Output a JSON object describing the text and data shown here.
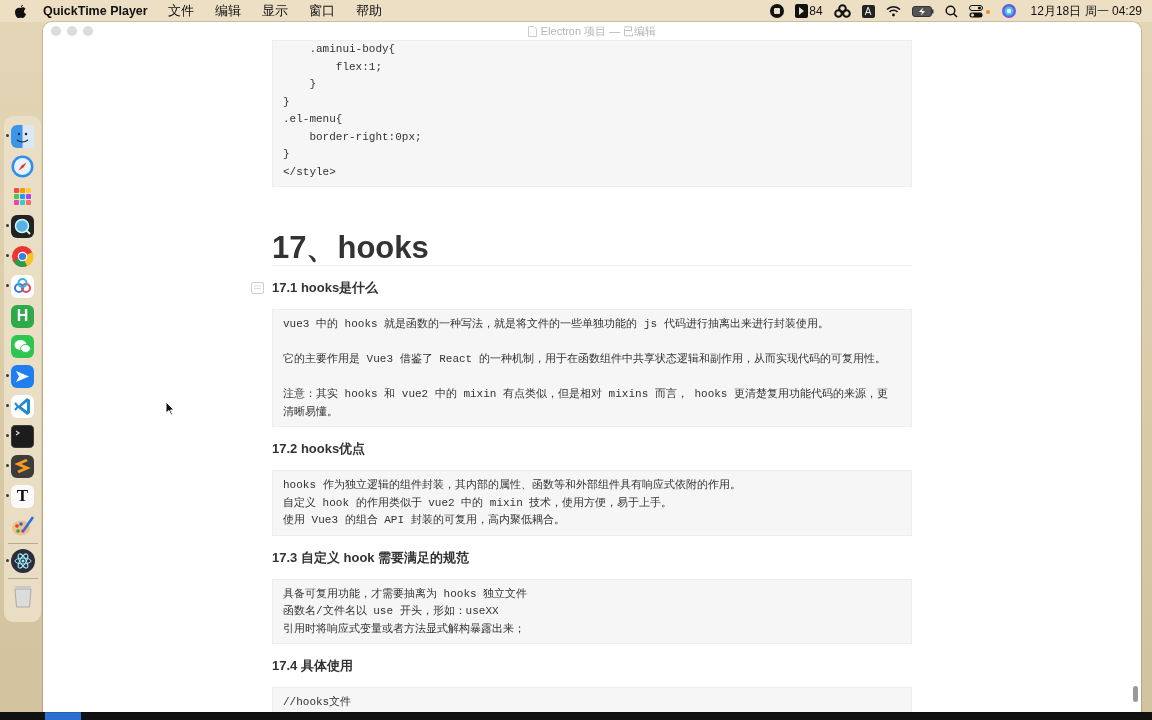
{
  "menu_bar": {
    "app_name": "QuickTime Player",
    "menus": [
      "文件",
      "编辑",
      "显示",
      "窗口",
      "帮助"
    ],
    "status": {
      "badge_count": "84",
      "input_method": "A",
      "clock": "12月18日 周一 04:29"
    }
  },
  "dock": {
    "items": [
      {
        "kind": "finder",
        "running": true
      },
      {
        "kind": "safari",
        "running": false
      },
      {
        "kind": "launchpad",
        "running": false
      },
      {
        "kind": "quicktime",
        "running": true
      },
      {
        "kind": "chrome",
        "running": true
      },
      {
        "kind": "baidu",
        "running": true
      },
      {
        "kind": "letter",
        "label": "H",
        "running": false
      },
      {
        "kind": "wechat",
        "running": false
      },
      {
        "kind": "feishu",
        "running": true
      },
      {
        "kind": "vscode",
        "running": true
      },
      {
        "kind": "terminal",
        "running": true
      },
      {
        "kind": "sublime",
        "running": true
      },
      {
        "kind": "serif",
        "label": "T",
        "running": true
      },
      {
        "kind": "paint",
        "running": false
      },
      {
        "kind": "separator"
      },
      {
        "kind": "electron",
        "running": true
      },
      {
        "kind": "separator"
      },
      {
        "kind": "trash",
        "running": false
      }
    ]
  },
  "window": {
    "title": "Electron 项目 — 已编辑"
  },
  "document": [
    {
      "kind": "code",
      "paragraphs": [
        [
          "    .aminui-body{",
          "        flex:1;",
          "    }",
          "}",
          ".el-menu{",
          "    border-right:0px;",
          "}",
          "</style>"
        ]
      ]
    },
    {
      "kind": "h1",
      "text": "17、hooks"
    },
    {
      "kind": "h2",
      "text": "17.1 hooks是什么",
      "handle": true
    },
    {
      "kind": "code",
      "paragraphs": [
        [
          "vue3 中的 hooks 就是函数的一种写法，就是将文件的一些单独功能的 js 代码进行抽离出来进行封装使用。"
        ],
        [
          "它的主要作用是 Vue3 借鉴了 React 的一种机制，用于在函数组件中共享状态逻辑和副作用，从而实现代码的可复用性。"
        ],
        [
          "注意：其实 hooks 和 vue2 中的 mixin 有点类似，但是相对 mixins 而言， hooks 更清楚复用功能代码的来源，更",
          "清晰易懂。"
        ]
      ]
    },
    {
      "kind": "h2",
      "text": "17.2 hooks优点"
    },
    {
      "kind": "code",
      "paragraphs": [
        [
          "hooks 作为独立逻辑的组件封装，其内部的属性、函数等和外部组件具有响应式依附的作用。",
          "自定义 hook 的作用类似于 vue2 中的 mixin 技术，使用方便，易于上手。",
          "使用 Vue3 的组合 API 封装的可复用，高内聚低耦合。"
        ]
      ]
    },
    {
      "kind": "h2",
      "text": "17.3 自定义 hook 需要满足的规范"
    },
    {
      "kind": "code",
      "paragraphs": [
        [
          "具备可复用功能，才需要抽离为 hooks 独立文件",
          "函数名/文件名以 use 开头，形如：useXX",
          "引用时将响应式变量或者方法显式解构暴露出来；"
        ]
      ]
    },
    {
      "kind": "h2",
      "text": "17.4 具体使用"
    },
    {
      "kind": "code",
      "paragraphs": [
        [
          "//hooks文件"
        ]
      ]
    }
  ]
}
